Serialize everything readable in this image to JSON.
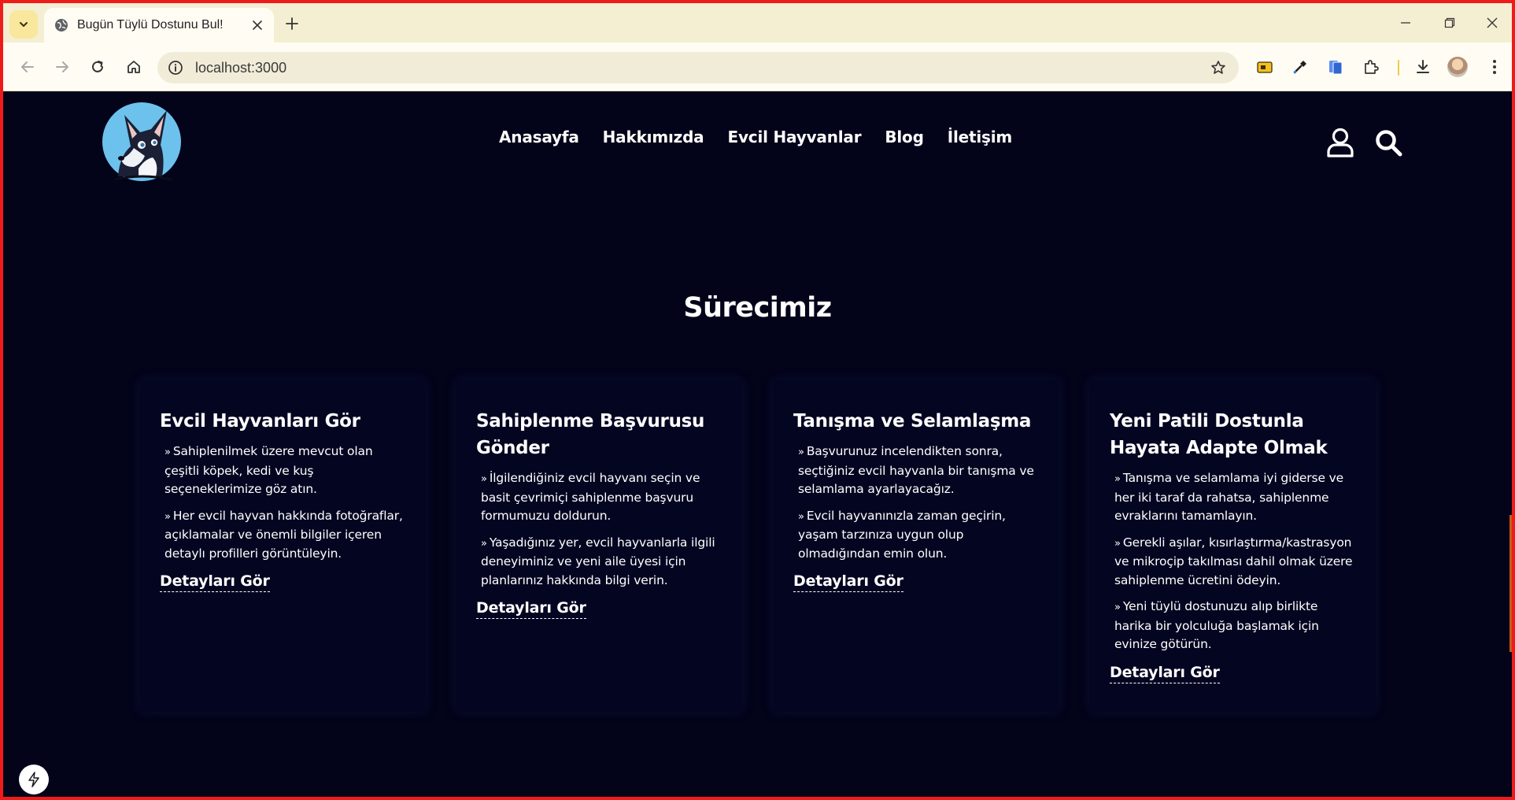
{
  "browser": {
    "tab_title": "Bugün Tüylü Dostunu Bul!",
    "url": "localhost:3000"
  },
  "header": {
    "nav": [
      "Anasayfa",
      "Hakkımızda",
      "Evcil Hayvanlar",
      "Blog",
      "İletişim"
    ]
  },
  "process": {
    "title": "Sürecimiz",
    "cards": [
      {
        "title": "Evcil Hayvanları Gör",
        "items": [
          "Sahiplenilmek üzere mevcut olan çeşitli köpek, kedi ve kuş seçeneklerimize göz atın.",
          "Her evcil hayvan hakkında fotoğraflar, açıklamalar ve önemli bilgiler içeren detaylı profilleri görüntüleyin."
        ],
        "link": "Detayları Gör"
      },
      {
        "title": "Sahiplenme Başvurusu Gönder",
        "items": [
          "İlgilendiğiniz evcil hayvanı seçin ve basit çevrimiçi sahiplenme başvuru formumuzu doldurun.",
          "Yaşadığınız yer, evcil hayvanlarla ilgili deneyiminiz ve yeni aile üyesi için planlarınız hakkında bilgi verin."
        ],
        "link": "Detayları Gör"
      },
      {
        "title": "Tanışma ve Selamlaşma",
        "items": [
          "Başvurunuz incelendikten sonra, seçtiğiniz evcil hayvanla bir tanışma ve selamlama ayarlayacağız.",
          "Evcil hayvanınızla zaman geçirin, yaşam tarzınıza uygun olup olmadığından emin olun."
        ],
        "link": "Detayları Gör"
      },
      {
        "title": "Yeni Patili Dostunla Hayata Adapte Olmak",
        "items": [
          "Tanışma ve selamlama iyi giderse ve her iki taraf da rahatsa, sahiplenme evraklarını tamamlayın.",
          "Gerekli aşılar, kısırlaştırma/kastrasyon ve mikroçip takılması dahil olmak üzere sahiplenme ücretini ödeyin.",
          "Yeni tüylü dostunuzu alıp birlikte harika bir yolculuğa başlamak için evinize götürün."
        ],
        "link": "Detayları Gör"
      }
    ]
  },
  "icons": {
    "chevron": "»",
    "header": [
      "user-icon",
      "search-icon"
    ],
    "browser": [
      "back-icon",
      "forward-icon",
      "reload-icon",
      "home-icon",
      "info-icon",
      "star-icon",
      "extension-icon",
      "download-icon",
      "more-icon"
    ]
  },
  "colors": {
    "page_bg": "#03031a",
    "card_bg": "#040621",
    "text": "#ffffff",
    "chrome_bg": "#f4efd2",
    "window_border": "#ef1b1b"
  }
}
